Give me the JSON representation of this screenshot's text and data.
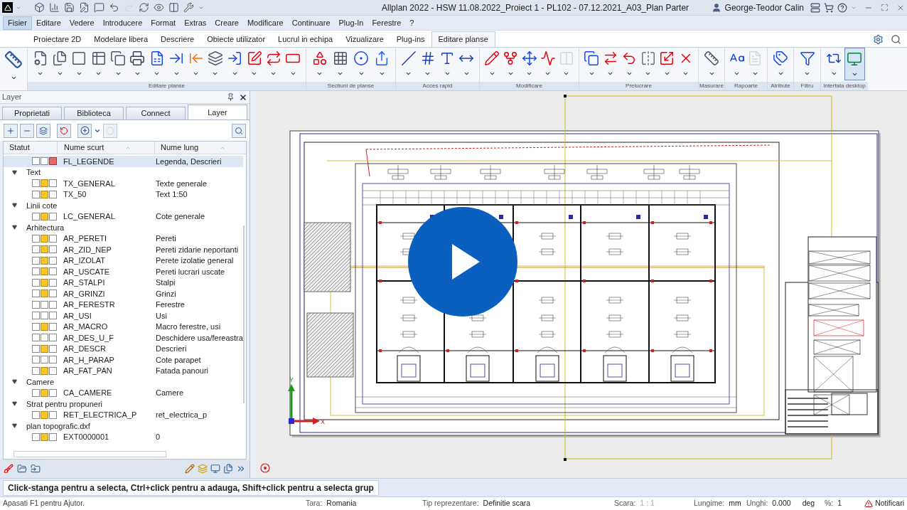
{
  "title_bar": {
    "title": "Allplan 2022 - HSW 11.08.2022_Proiect 1 - PL102 - 07.12.2021_A03_Plan Parter",
    "user": "George-Teodor Calin"
  },
  "menu": [
    {
      "label": "Fisier",
      "selected": true
    },
    {
      "label": "Editare",
      "selected": false
    },
    {
      "label": "Vedere",
      "selected": false
    },
    {
      "label": "Introducere",
      "selected": false
    },
    {
      "label": "Format",
      "selected": false
    },
    {
      "label": "Extras",
      "selected": false
    },
    {
      "label": "Creare",
      "selected": false
    },
    {
      "label": "Modificare",
      "selected": false
    },
    {
      "label": "Continuare",
      "selected": false
    },
    {
      "label": "Plug-In",
      "selected": false
    },
    {
      "label": "Ferestre",
      "selected": false
    },
    {
      "label": "?",
      "selected": false
    }
  ],
  "ribbon": {
    "tabs": [
      {
        "label": "Proiectare 2D",
        "selected": false
      },
      {
        "label": "Modelare libera",
        "selected": false
      },
      {
        "label": "Descriere",
        "selected": false
      },
      {
        "label": "Obiecte utilizator",
        "selected": false
      },
      {
        "label": "Lucrul in echipa",
        "selected": false
      },
      {
        "label": "Vizualizare",
        "selected": false
      },
      {
        "label": "Plug-ins",
        "selected": false
      },
      {
        "label": "Editare planse",
        "selected": true
      }
    ],
    "groups": [
      {
        "label": "Editare planse"
      },
      {
        "label": "Sectiuni de planse"
      },
      {
        "label": "Acces rapid"
      },
      {
        "label": "Modificare"
      },
      {
        "label": "Prelucrare"
      },
      {
        "label": "Masurare"
      },
      {
        "label": "Rapoarte"
      },
      {
        "label": "Atribute"
      },
      {
        "label": "Filtru"
      },
      {
        "label": "Interfata desktop"
      }
    ]
  },
  "layer_panel": {
    "title": "Layer",
    "tabs": [
      {
        "label": "Proprietati",
        "selected": false
      },
      {
        "label": "Biblioteca",
        "selected": false
      },
      {
        "label": "Connect",
        "selected": false
      },
      {
        "label": "Layer",
        "selected": true
      }
    ],
    "columns": [
      "Statut",
      "Nume scurt",
      "Nume lung"
    ],
    "tree": [
      {
        "kind": "layer",
        "short": "FL_LEGENDE",
        "long": "Legenda, Descrieri",
        "editable": false,
        "current": true,
        "selected": true
      },
      {
        "kind": "group",
        "name": "Text",
        "expanded": true,
        "children": [
          {
            "kind": "layer",
            "short": "TX_GENERAL",
            "long": "Texte generale",
            "editable": true,
            "current": false,
            "selected": false
          },
          {
            "kind": "layer",
            "short": "TX_50",
            "long": "Text 1:50",
            "editable": true,
            "current": false,
            "selected": false
          }
        ]
      },
      {
        "kind": "group",
        "name": "Linii cote",
        "expanded": true,
        "children": [
          {
            "kind": "layer",
            "short": "LC_GENERAL",
            "long": "Cote generale",
            "editable": true,
            "current": false,
            "selected": false
          }
        ]
      },
      {
        "kind": "group",
        "name": "Arhitectura",
        "expanded": true,
        "children": [
          {
            "kind": "layer",
            "short": "AR_PERETI",
            "long": "Pereti",
            "editable": true,
            "current": false,
            "selected": false
          },
          {
            "kind": "layer",
            "short": "AR_ZID_NEP",
            "long": "Pereti zidarie neportanti",
            "editable": true,
            "current": false,
            "selected": false
          },
          {
            "kind": "layer",
            "short": "AR_IZOLAT",
            "long": "Perete izolatie general",
            "editable": true,
            "current": false,
            "selected": false
          },
          {
            "kind": "layer",
            "short": "AR_USCATE",
            "long": "Pereti lucrari uscate",
            "editable": true,
            "current": false,
            "selected": false
          },
          {
            "kind": "layer",
            "short": "AR_STALPI",
            "long": "Stalpi",
            "editable": true,
            "current": false,
            "selected": false
          },
          {
            "kind": "layer",
            "short": "AR_GRINZI",
            "long": "Grinzi",
            "editable": true,
            "current": false,
            "selected": false
          },
          {
            "kind": "layer",
            "short": "AR_FERESTR",
            "long": "Ferestre",
            "editable": false,
            "current": false,
            "selected": false
          },
          {
            "kind": "layer",
            "short": "AR_USI",
            "long": "Usi",
            "editable": false,
            "current": false,
            "selected": false
          },
          {
            "kind": "layer",
            "short": "AR_MACRO",
            "long": "Macro ferestre, usi",
            "editable": true,
            "current": false,
            "selected": false
          },
          {
            "kind": "layer",
            "short": "AR_DES_U_F",
            "long": "Deschidere usa/fereastra",
            "editable": false,
            "current": false,
            "selected": false
          },
          {
            "kind": "layer",
            "short": "AR_DESCR",
            "long": "Descrieri",
            "editable": true,
            "current": false,
            "selected": false
          },
          {
            "kind": "layer",
            "short": "AR_H_PARAP",
            "long": "Cote parapet",
            "editable": false,
            "current": false,
            "selected": false
          },
          {
            "kind": "layer",
            "short": "AR_FAT_PAN",
            "long": "Fatada panouri",
            "editable": true,
            "current": false,
            "selected": false
          }
        ]
      },
      {
        "kind": "group",
        "name": "Camere",
        "expanded": true,
        "children": [
          {
            "kind": "layer",
            "short": "CA_CAMERE",
            "long": "Camere",
            "editable": true,
            "current": false,
            "selected": false
          }
        ]
      },
      {
        "kind": "group",
        "name": "Strat pentru propuneri",
        "expanded": true,
        "children": [
          {
            "kind": "layer",
            "short": "RET_ELECTRICA_P",
            "long": "ret_electrica_p",
            "editable": true,
            "current": false,
            "selected": false
          }
        ]
      },
      {
        "kind": "group",
        "name": "plan topografic.dxf",
        "expanded": true,
        "children": [
          {
            "kind": "layer",
            "short": "EXT0000001",
            "long": "0",
            "editable": true,
            "current": false,
            "selected": false
          }
        ]
      }
    ]
  },
  "canvas": {
    "axis_x": "X",
    "axis_y": "Y"
  },
  "prompt": "Click-stanga pentru a selecta, Ctrl+click pentru a adauga, Shift+click pentru a selecta grup",
  "status_bar": {
    "help": "Apasati F1 pentru Ajutor.",
    "fields": [
      {
        "label": "Tara:",
        "value": "Romania",
        "disabled": false
      },
      {
        "label": "Tip reprezentare:",
        "value": "Definitie scara",
        "disabled": false
      },
      {
        "label": "Scara:",
        "value": "1 : 1",
        "disabled": true
      },
      {
        "label": "Lungime:",
        "value": "mm",
        "disabled": false
      },
      {
        "label": "Unghi:",
        "value": "0.000",
        "unit": "deg",
        "disabled": false
      },
      {
        "label": "%:",
        "value": "1",
        "disabled": false
      }
    ],
    "notifications": "Notificari"
  }
}
